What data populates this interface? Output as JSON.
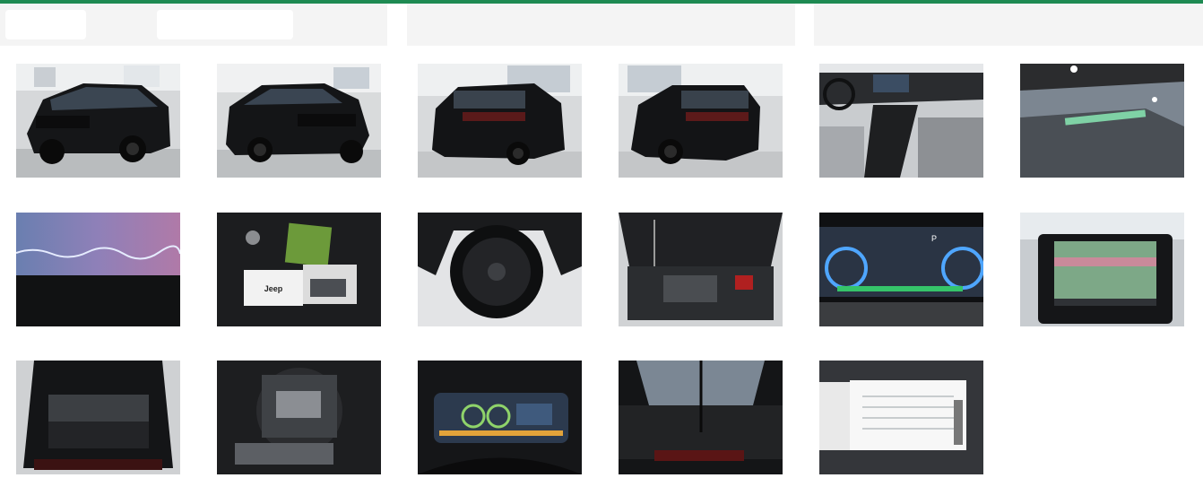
{
  "colors": {
    "accent": "#1e8a52",
    "panel": "#f4f4f4",
    "chip": "#ffffff"
  },
  "gallery": {
    "photos": [
      {
        "subject": "front-left-exterior"
      },
      {
        "subject": "front-right-exterior"
      },
      {
        "subject": "rear-left-exterior"
      },
      {
        "subject": "rear-right-exterior"
      },
      {
        "subject": "front-interior-dashboard"
      },
      {
        "subject": "windshield-detail"
      },
      {
        "subject": "ambient-lighting-strip"
      },
      {
        "subject": "keys-and-manuals"
      },
      {
        "subject": "wheel-rim"
      },
      {
        "subject": "engine-bay"
      },
      {
        "subject": "digital-instrument-cluster"
      },
      {
        "subject": "infotainment-screen"
      },
      {
        "subject": "open-trunk"
      },
      {
        "subject": "spare-tire-kit"
      },
      {
        "subject": "cluster-display-detail"
      },
      {
        "subject": "sunroof-view"
      },
      {
        "subject": "registration-document"
      }
    ]
  },
  "photo_text": {
    "manual_brand": "Jeep",
    "cluster_gear": "P"
  }
}
